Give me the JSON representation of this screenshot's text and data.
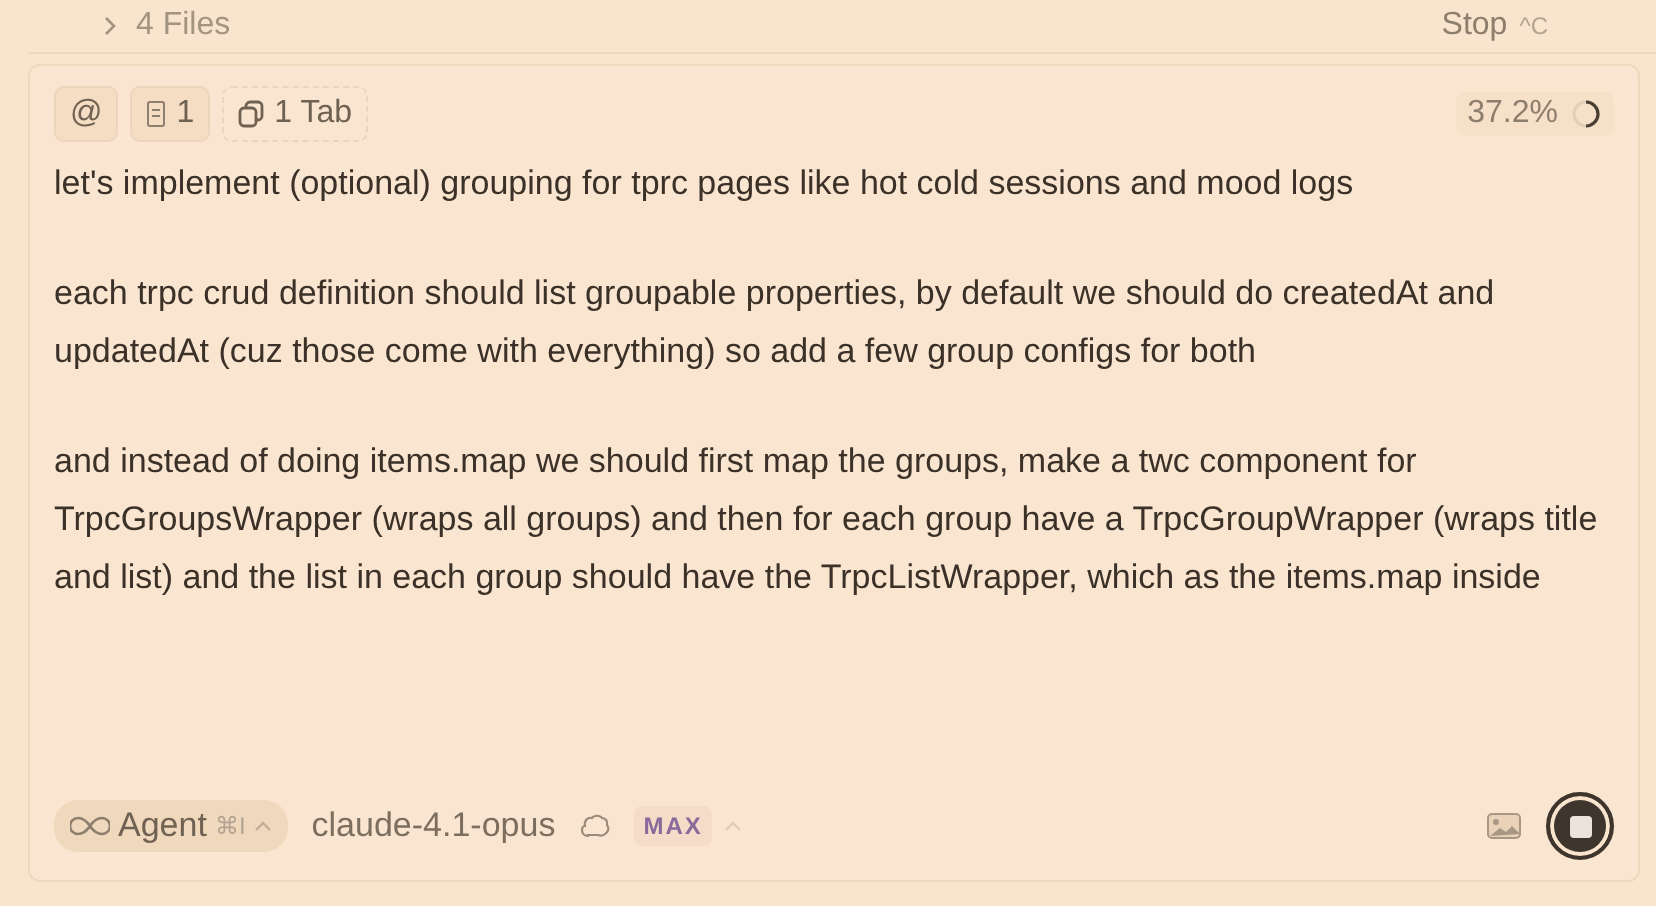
{
  "files_bar": {
    "label": "4 Files",
    "expanded": false
  },
  "stop": {
    "label": "Stop",
    "shortcut": "^C"
  },
  "chips": [
    {
      "kind": "mention",
      "label": "@"
    },
    {
      "kind": "file",
      "label": "1"
    },
    {
      "kind": "tab",
      "label": "1 Tab"
    }
  ],
  "context_usage": "37.2%",
  "paragraphs": [
    "let's implement (optional) grouping for tprc pages like hot cold sessions and mood logs",
    "each trpc crud definition should list groupable properties, by default we should do createdAt and updatedAt (cuz those come with everything) so add a few group configs for both",
    "and instead of doing items.map we should first map the groups, make a twc component for TrpcGroupsWrapper (wraps all groups) and then for each group have a TrpcGroupWrapper (wraps title and list) and the list in each group should have the TrpcListWrapper, which as the items.map inside"
  ],
  "footer": {
    "mode": {
      "label": "Agent",
      "shortcut": "⌘I"
    },
    "model": "claude-4.1-opus",
    "badge": "MAX"
  }
}
